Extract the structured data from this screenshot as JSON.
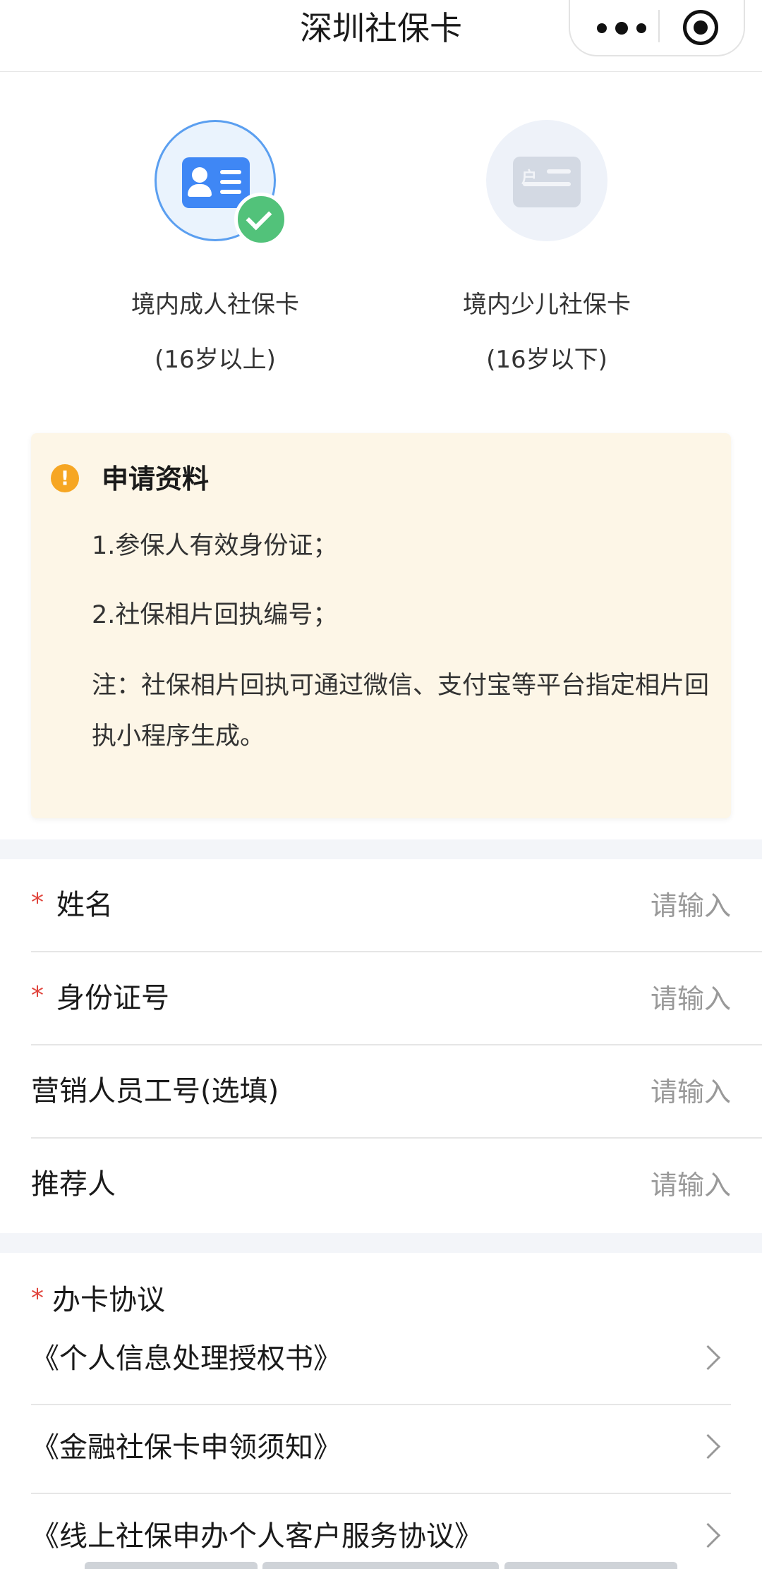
{
  "header": {
    "title": "深圳社保卡"
  },
  "card_types": {
    "adult": {
      "label": "境内成人社保卡",
      "sub": "(16岁以上)",
      "selected": true
    },
    "child": {
      "label": "境内少儿社保卡",
      "sub": "(16岁以下)",
      "selected": false
    }
  },
  "notice": {
    "heading": "申请资料",
    "items": [
      "1.参保人有效身份证；",
      "2.社保相片回执编号；",
      "注：社保相片回执可通过微信、支付宝等平台指定相片回执小程序生成。"
    ],
    "icon_color": "#f6a623",
    "background": "#fdf6e7"
  },
  "form": {
    "required_marker": "*",
    "fields": [
      {
        "label": "姓名",
        "placeholder": "请输入",
        "required": true
      },
      {
        "label": "身份证号",
        "placeholder": "请输入",
        "required": true
      },
      {
        "label": "营销人员工号(选填)",
        "placeholder": "请输入",
        "required": false
      },
      {
        "label": "推荐人",
        "placeholder": "请输入",
        "required": false
      }
    ]
  },
  "agreements": {
    "title": "办卡协议",
    "required": true,
    "items": [
      "《个人信息处理授权书》",
      "《金融社保卡申领须知》",
      "《线上社保申办个人客户服务协议》"
    ]
  },
  "colors": {
    "accent_blue": "#3f87f5",
    "success_green": "#52c27a",
    "required_red": "#e0433b",
    "separator_gray": "#f3f5f9"
  }
}
